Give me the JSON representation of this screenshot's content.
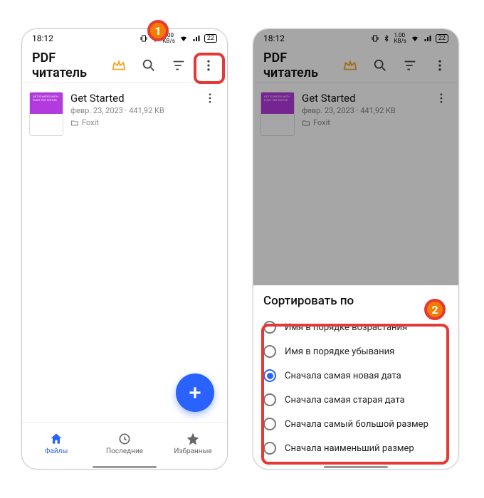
{
  "status": {
    "time": "18:12",
    "icons": [
      "vibrate",
      "bluetooth",
      "speed",
      "wifi",
      "sim",
      "signal",
      "battery"
    ],
    "battery_text": "22"
  },
  "app": {
    "title": "PDF читатель",
    "toolbar": {
      "crown": "crown-icon",
      "search": "search-icon",
      "sort": "sort-icon",
      "more": "more-icon"
    }
  },
  "file": {
    "name": "Get Started",
    "meta": "февр. 23, 2023 · 441,92 KB",
    "folder": "Foxit",
    "thumb_caption": "GET STARTED WITH FOXIT PDF EDITOR"
  },
  "nav": {
    "files": "Файлы",
    "recent": "Последние",
    "fav": "Избранные"
  },
  "sort_sheet": {
    "title": "Сортировать по",
    "options": [
      "Имя в порядке возрастания",
      "Имя в порядке убывания",
      "Сначала самая новая дата",
      "Сначала самая старая дата",
      "Сначала самый большой размер",
      "Сначала наименьший размер"
    ],
    "selected_index": 2
  },
  "callouts": {
    "one": "1",
    "two": "2"
  }
}
